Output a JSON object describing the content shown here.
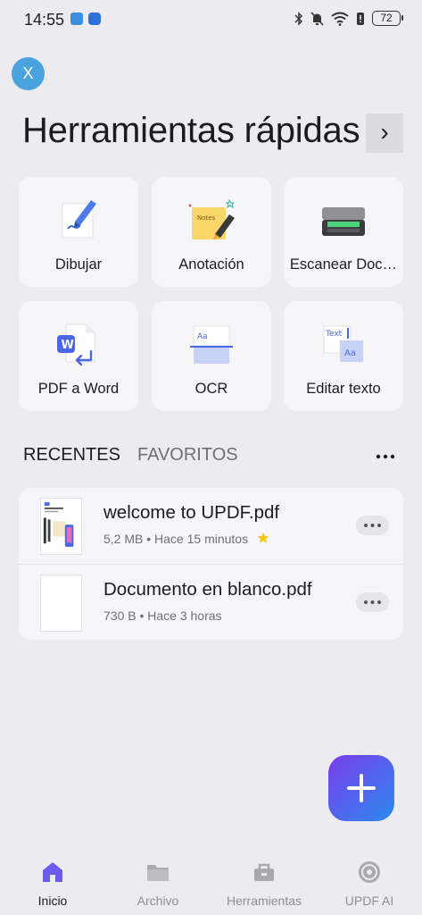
{
  "status_bar": {
    "time": "14:55",
    "battery": "72"
  },
  "close_button": {
    "label": "X"
  },
  "header": {
    "title": "Herramientas rápidas",
    "arrow": "›"
  },
  "tools": [
    {
      "label": "Dibujar",
      "icon": "pen-drawing-icon"
    },
    {
      "label": "Anotación",
      "icon": "sticky-note-icon",
      "note_text": "Notes"
    },
    {
      "label": "Escanear Doc…",
      "icon": "scanner-icon"
    },
    {
      "label": "PDF a Word",
      "icon": "word-document-icon",
      "badge": "W"
    },
    {
      "label": "OCR",
      "icon": "ocr-icon",
      "sample": "Aa"
    },
    {
      "label": "Editar texto",
      "icon": "edit-text-icon",
      "sample_top": "Text",
      "sample_bottom": "Aa"
    }
  ],
  "tabs": {
    "recent": "RECENTES",
    "favorites": "FAVORITOS"
  },
  "files": [
    {
      "name": "welcome to UPDF.pdf",
      "meta": "5,2 MB • Hace 15 minutos",
      "starred": true
    },
    {
      "name": "Documento en blanco.pdf",
      "meta": "730 B • Hace 3 horas",
      "starred": false
    }
  ],
  "fab": {
    "icon": "plus-icon"
  },
  "bottom_nav": [
    {
      "label": "Inicio",
      "icon": "home-icon",
      "active": true
    },
    {
      "label": "Archivo",
      "icon": "folder-icon",
      "active": false
    },
    {
      "label": "Herramientas",
      "icon": "toolbox-icon",
      "active": false
    },
    {
      "label": "UPDF AI",
      "icon": "ai-sparkle-icon",
      "active": false
    }
  ],
  "colors": {
    "background": "#ececf0",
    "card": "#f6f6f8",
    "accent": "#4f66ee",
    "star": "#f5c518",
    "nav_active": "#6a5cf0"
  }
}
